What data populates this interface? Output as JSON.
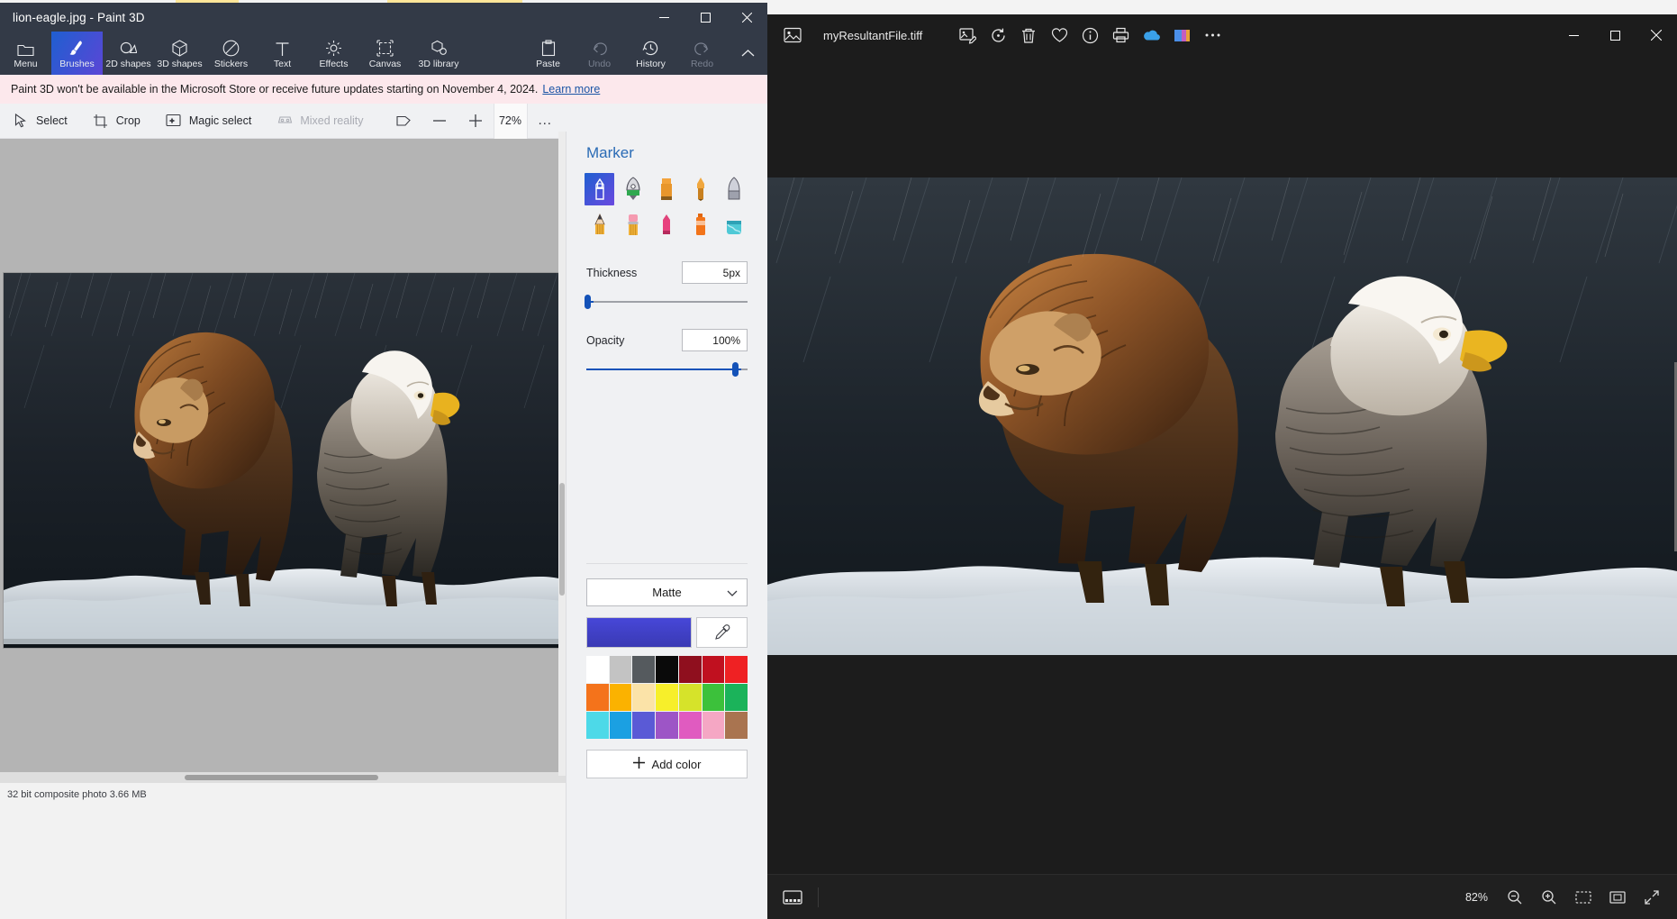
{
  "paint3d": {
    "window_title": "lion-eagle.jpg - Paint 3D",
    "window_controls": {
      "minimize": "minimize-icon",
      "maximize": "maximize-icon",
      "close": "close-icon"
    },
    "ribbon": [
      {
        "label": "Menu",
        "icon": "folder-icon",
        "state": "normal"
      },
      {
        "label": "Brushes",
        "icon": "brush-icon",
        "state": "active"
      },
      {
        "label": "2D shapes",
        "icon": "2d-shapes-icon",
        "state": "normal"
      },
      {
        "label": "3D shapes",
        "icon": "3d-shapes-icon",
        "state": "normal"
      },
      {
        "label": "Stickers",
        "icon": "stickers-icon",
        "state": "normal"
      },
      {
        "label": "Text",
        "icon": "text-icon",
        "state": "normal"
      },
      {
        "label": "Effects",
        "icon": "effects-icon",
        "state": "normal"
      },
      {
        "label": "Canvas",
        "icon": "canvas-icon",
        "state": "normal"
      },
      {
        "label": "3D library",
        "icon": "3d-library-icon",
        "state": "normal"
      },
      {
        "label": "Paste",
        "icon": "paste-icon",
        "state": "normal"
      },
      {
        "label": "Undo",
        "icon": "undo-icon",
        "state": "disabled"
      },
      {
        "label": "History",
        "icon": "history-icon",
        "state": "normal"
      },
      {
        "label": "Redo",
        "icon": "redo-icon",
        "state": "disabled"
      }
    ],
    "banner": {
      "text": "Paint 3D won't be available in the Microsoft Store or receive future updates starting on November 4, 2024.",
      "link": "Learn more"
    },
    "subbar": {
      "select": "Select",
      "crop": "Crop",
      "magic_select": "Magic select",
      "mixed_reality": "Mixed reality",
      "view3d_icon": "view-3d-icon",
      "zoom_out": "minus-icon",
      "zoom_in": "plus-icon",
      "zoom_value": "72%",
      "more": "…"
    },
    "statusbar": "32 bit composite photo 3.66 MB",
    "panel": {
      "title": "Marker",
      "brushes": [
        {
          "name": "marker",
          "selected": true
        },
        {
          "name": "calligraphy-pen",
          "selected": false
        },
        {
          "name": "oil-brush",
          "selected": false
        },
        {
          "name": "watercolor",
          "selected": false
        },
        {
          "name": "pixel-pen",
          "selected": false
        },
        {
          "name": "pencil",
          "selected": false
        },
        {
          "name": "eraser",
          "selected": false
        },
        {
          "name": "crayon",
          "selected": false
        },
        {
          "name": "spray-can",
          "selected": false
        },
        {
          "name": "fill-bucket",
          "selected": false
        }
      ],
      "thickness_label": "Thickness",
      "thickness_value": "5px",
      "thickness_pct": 5,
      "opacity_label": "Opacity",
      "opacity_value": "100%",
      "opacity_pct": 100,
      "material": "Matte",
      "current_color": "#4747d8",
      "eyedropper_icon": "eyedropper-icon",
      "swatches": [
        "#ffffff",
        "#c3c3c3",
        "#555a5e",
        "#0a0a0a",
        "#8f0f1e",
        "#c0101f",
        "#ef2123",
        "#f4731b",
        "#fbb200",
        "#fbe3a8",
        "#f7ef2a",
        "#d6e32a",
        "#3cc13b",
        "#1bb35a",
        "#4dd9e8",
        "#1ba0e2",
        "#5a5ad6",
        "#9d55c6",
        "#e05bc0",
        "#f5a7c4",
        "#a97450"
      ],
      "add_color": "Add color",
      "add_color_icon": "plus-icon"
    }
  },
  "photos": {
    "app_icon": "photo-app-icon",
    "filename": "myResultantFile.tiff",
    "toolbar": [
      {
        "name": "edit-image-icon",
        "label": "Edit image"
      },
      {
        "name": "rotate-icon",
        "label": "Rotate"
      },
      {
        "name": "delete-icon",
        "label": "Delete"
      },
      {
        "name": "heart-icon",
        "label": "Add to favorites"
      },
      {
        "name": "info-icon",
        "label": "File info"
      },
      {
        "name": "print-icon",
        "label": "Print"
      },
      {
        "name": "onedrive-icon",
        "label": "OneDrive"
      },
      {
        "name": "gallery-icon",
        "label": "Gallery"
      },
      {
        "name": "more-icon",
        "label": "See more"
      }
    ],
    "window_controls": {
      "minimize": "minimize-icon",
      "maximize": "maximize-icon",
      "close": "close-icon"
    },
    "bottom": {
      "filmstrip_icon": "filmstrip-icon",
      "zoom_value": "82%",
      "zoom_out_icon": "zoom-out-icon",
      "zoom_in_icon": "zoom-in-icon",
      "fit_icon": "fit-to-window-icon",
      "actual_size_icon": "actual-size-icon",
      "fullscreen_icon": "fullscreen-icon"
    }
  }
}
